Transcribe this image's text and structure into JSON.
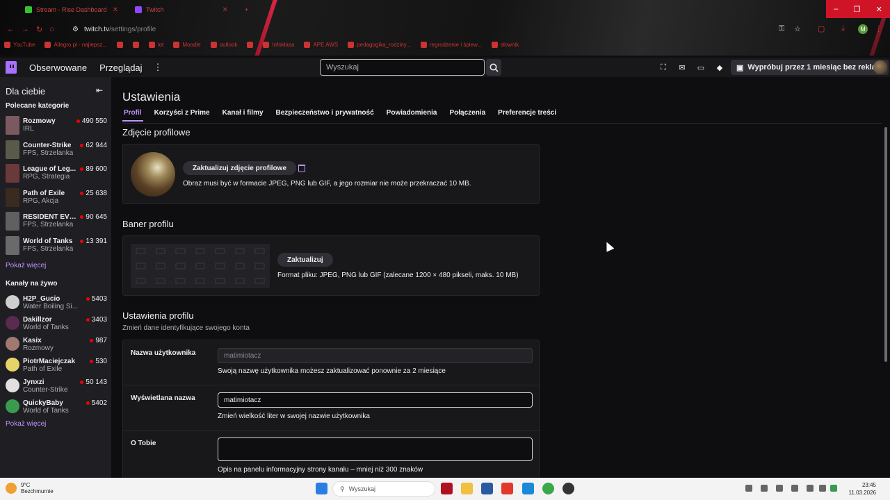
{
  "browser": {
    "tabs": [
      {
        "title": "Stream - Rise Dashboard",
        "color": "#35c235"
      },
      {
        "title": "Twitch",
        "color": "#9146ff"
      }
    ],
    "url_host": "twitch.tv",
    "url_path": "/settings/profile",
    "bookmarks": [
      "YouTube",
      "Allegro.pl - najlepsz...",
      "",
      "",
      "lot",
      "Moodle",
      "outlook",
      "",
      "Infoklasa",
      "APE AWS",
      "pedagogika_rodziny...",
      "regrodzenie i śpiew...",
      "słownik"
    ]
  },
  "topnav": {
    "following": "Obserwowane",
    "browse": "Przeglądaj",
    "more": "⋮",
    "search_placeholder": "Wyszukaj",
    "adfree": "Wypróbuj przez 1 miesiąc bez reklam"
  },
  "sidebar": {
    "title": "Dla ciebie",
    "categories_title": "Polecane kategorie",
    "categories": [
      {
        "name": "Rozmowy",
        "sub": "IRL",
        "count": "490 550",
        "color": "#7a5a60"
      },
      {
        "name": "Counter-Strike",
        "sub": "FPS, Strzelanka",
        "count": "62 944",
        "color": "#5a5a4a"
      },
      {
        "name": "League of Leg...",
        "sub": "RPG, Strategia",
        "count": "89 600",
        "color": "#6a3a3a"
      },
      {
        "name": "Path of Exile",
        "sub": "RPG, Akcja",
        "count": "25 638",
        "color": "#3a2a20"
      },
      {
        "name": "RESIDENT EVIL...",
        "sub": "FPS, Strzelanka",
        "count": "90 645",
        "color": "#606060"
      },
      {
        "name": "World of Tanks",
        "sub": "FPS, Strzelanka",
        "count": "13 391",
        "color": "#6a6a6a"
      }
    ],
    "show_more": "Pokaż więcej",
    "live_title": "Kanały na żywo",
    "channels": [
      {
        "name": "H2P_Gucio",
        "sub": "Water Boiling Si...",
        "count": "5403",
        "color": "#cfcfcf"
      },
      {
        "name": "Dakillzor",
        "sub": "World of Tanks",
        "count": "3403",
        "color": "#5a2a50"
      },
      {
        "name": "Kasix",
        "sub": "Rozmowy",
        "count": "987",
        "color": "#a07a70"
      },
      {
        "name": "PiotrMaciejczak",
        "sub": "Path of Exile",
        "count": "530",
        "color": "#e6d36a"
      },
      {
        "name": "Jynxzi",
        "sub": "Counter-Strike",
        "count": "50 143",
        "color": "#e0e0e0"
      },
      {
        "name": "QuickyBaby",
        "sub": "World of Tanks",
        "count": "5402",
        "color": "#3a9a50"
      }
    ],
    "show_more_2": "Pokaż więcej"
  },
  "main": {
    "title": "Ustawienia",
    "tabs": [
      "Profil",
      "Korzyści z Prime",
      "Kanał i filmy",
      "Bezpieczeństwo i prywatność",
      "Powiadomienia",
      "Połączenia",
      "Preferencje treści"
    ],
    "profile_photo": {
      "heading": "Zdjęcie profilowe",
      "button": "Zaktualizuj zdjęcie profilowe",
      "note": "Obraz musi być w formacie JPEG, PNG lub GIF, a jego rozmiar nie może przekraczać 10 MB."
    },
    "banner": {
      "heading": "Baner profilu",
      "button": "Zaktualizuj",
      "note": "Format pliku: JPEG, PNG lub GIF (zalecane 1200 × 480 pikseli, maks. 10 MB)"
    },
    "profile_settings": {
      "heading": "Ustawienia profilu",
      "subheading": "Zmień dane identyfikujące swojego konta",
      "username_label": "Nazwa użytkownika",
      "username_value": "matimiotacz",
      "username_help": "Swoją nazwę użytkownika możesz zaktualizować ponownie za 2 miesiące",
      "display_label": "Wyświetlana nazwa",
      "display_value": "matimiotacz",
      "display_help": "Zmień wielkość liter w swojej nazwie użytkownika",
      "bio_label": "O Tobie",
      "bio_value": "",
      "bio_help": "Opis na panelu informacyjny strony kanału – mniej niż 300 znaków"
    }
  },
  "taskbar": {
    "temp": "9°C",
    "weather": "Bezchmurnie",
    "search": "Wyszukaj",
    "time": "23:45",
    "date": "11.03.2026"
  },
  "colors": {
    "accent": "#bf94ff",
    "brand": "#9146ff",
    "live": "#eb0400"
  }
}
